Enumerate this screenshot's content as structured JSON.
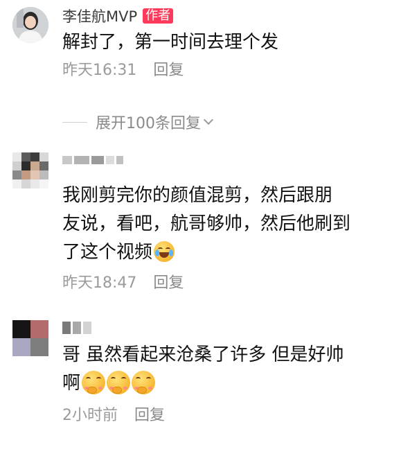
{
  "comments": [
    {
      "username": "李佳航MVP",
      "badge": "作者",
      "text": "解封了，第一时间去理个发",
      "time": "昨天16:31",
      "reply_label": "回复",
      "expand_label": "展开100条回复"
    },
    {
      "text_line1": "我刚剪完你的颜值混剪，然后跟朋",
      "text_line2": "友说，看吧，航哥够帅，然后他刷到",
      "text_line3": "了这个视频",
      "emoji": "laughing-crying-emoji",
      "time": "昨天18:47",
      "reply_label": "回复"
    },
    {
      "text_line1": "哥 虽然看起来沧桑了许多 但是好帅",
      "text_line2": "啊",
      "emoji": "pleading-emoji",
      "time": "2小时前",
      "reply_label": "回复"
    }
  ],
  "colors": {
    "badge": "#ff3b5c",
    "meta_text": "#9a9a9a",
    "body_text": "#111111"
  }
}
